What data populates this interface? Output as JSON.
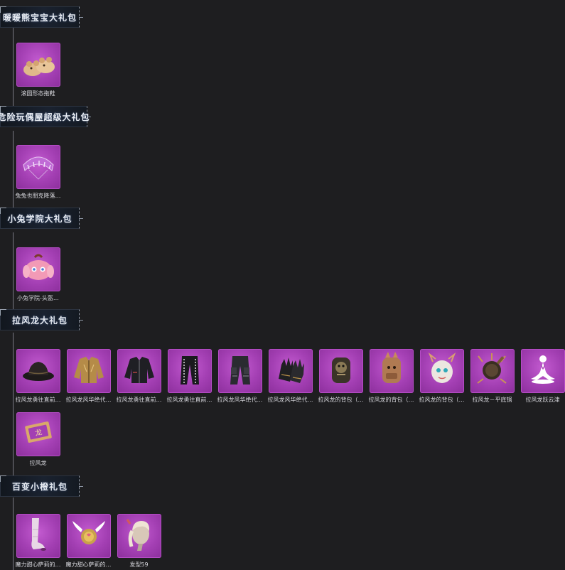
{
  "sections": [
    {
      "title": "暖暖熊宝宝大礼包",
      "items": [
        {
          "label": "滚圆形态拖鞋",
          "icon": "bear-slippers-icon"
        }
      ]
    },
    {
      "title": "危险玩偶屋超级大礼包",
      "items": [
        {
          "label": "兔兔也朋克降落…",
          "icon": "bunny-punk-parachute-icon"
        }
      ]
    },
    {
      "title": "小兔学院大礼包",
      "items": [
        {
          "label": "小兔学院-头盔…",
          "icon": "bunny-helmet-icon"
        }
      ]
    },
    {
      "title": "拉风龙大礼包",
      "items": [
        {
          "label": "拉风龙勇往直前…",
          "icon": "bucket-hat-icon"
        },
        {
          "label": "拉风龙风华绝代…",
          "icon": "gold-jacket-icon"
        },
        {
          "label": "拉风龙勇往直前…",
          "icon": "black-jacket-icon"
        },
        {
          "label": "拉风龙勇往直前…",
          "icon": "black-pants-icon"
        },
        {
          "label": "拉风龙风华绝代…",
          "icon": "cargo-pants-icon"
        },
        {
          "label": "拉风龙风华绝代…",
          "icon": "gloves-icon"
        },
        {
          "label": "拉风龙的背包（…",
          "icon": "dark-dragon-backpack-icon"
        },
        {
          "label": "拉风龙的背包（…",
          "icon": "brown-dragon-backpack-icon"
        },
        {
          "label": "拉风龙的背包（…",
          "icon": "white-dragon-backpack-icon"
        },
        {
          "label": "拉风龙－平底锅",
          "icon": "dragon-pan-icon"
        },
        {
          "label": "拉风龙跃云津",
          "icon": "emote-pose-icon"
        },
        {
          "label": "拉风龙",
          "icon": "dragon-card-icon"
        }
      ]
    },
    {
      "title": "百变小橙礼包",
      "items": [
        {
          "label": "魔力甜心萨莉的…",
          "icon": "boots-icon"
        },
        {
          "label": "魔力甜心萨莉的…",
          "icon": "winged-pan-icon"
        },
        {
          "label": "发型59",
          "icon": "hairstyle-icon"
        }
      ]
    }
  ],
  "colors": {
    "background": "#1e1e20",
    "tile": "#a33fb3",
    "header": "#1a2230",
    "label": "#d8d8de"
  }
}
